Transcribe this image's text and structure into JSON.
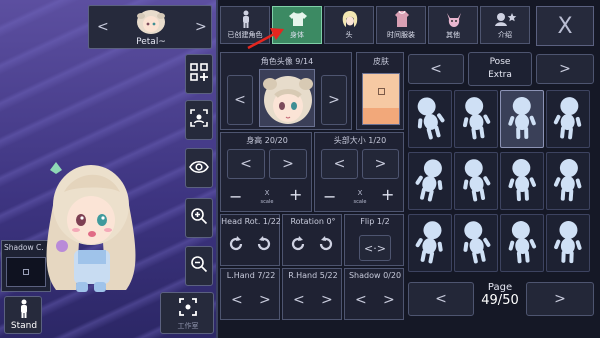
{
  "character": {
    "name": "Petal~"
  },
  "shadow_panel": {
    "label": "Shadow C."
  },
  "stand_button": {
    "label": "Stand"
  },
  "left_tools": [
    "add-items-icon",
    "scan-face-icon",
    "eye-icon",
    "zoom-in-icon",
    "zoom-out-icon"
  ],
  "bottom_tool": {
    "label": "工作室"
  },
  "tabs": [
    {
      "label": "已创建角色",
      "icon": "person-icon"
    },
    {
      "label": "身体",
      "icon": "shirt-icon"
    },
    {
      "label": "头",
      "icon": "hair-icon"
    },
    {
      "label": "时间服装",
      "icon": "outfit-icon"
    },
    {
      "label": "其他",
      "icon": "pet-icon"
    },
    {
      "label": "介绍",
      "icon": "profile-icon"
    }
  ],
  "close_label": "X",
  "head_section": {
    "title": "角色头像 9/14",
    "skin_title": "皮肤"
  },
  "height": {
    "title": "身高 20/20",
    "scale_label": "X\nscale"
  },
  "head_size": {
    "title": "头部大小 1/20",
    "scale_label": "X\nscale"
  },
  "head_rot": {
    "title": "Head Rot. 1/22"
  },
  "rotation": {
    "title": "Rotation 0°"
  },
  "flip": {
    "title": "Flip 1/2"
  },
  "lhand": {
    "title": "L.Hand 7/22"
  },
  "rhand": {
    "title": "R.Hand 5/22"
  },
  "shadow": {
    "title": "Shadow 0/20"
  },
  "pose": {
    "line1": "Pose",
    "line2": "Extra"
  },
  "page": {
    "label": "Page",
    "value": "49/50"
  },
  "colors": {
    "skin_top": "#f6c9a3",
    "skin_bottom": "#f2a87a",
    "accent_green": "#3c8a63",
    "pose_figure": "#cfe0f5"
  }
}
